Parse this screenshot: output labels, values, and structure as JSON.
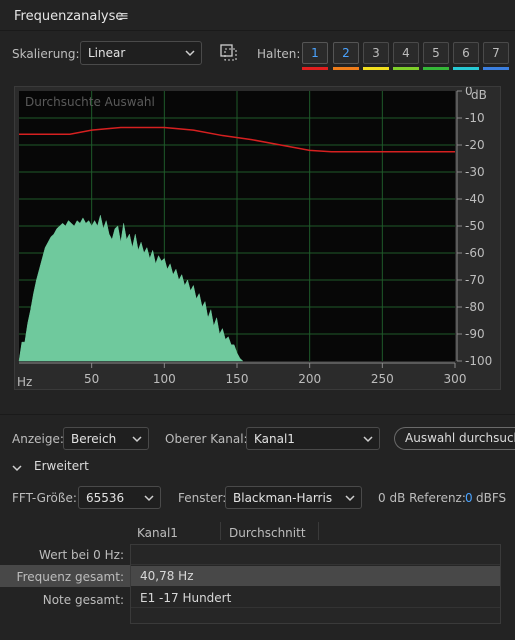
{
  "panel": {
    "title": "Frequenzanalyse",
    "menu_glyph": "≡"
  },
  "toolbar": {
    "scale_label": "Skalierung:",
    "scale_value": "Linear",
    "hold_label": "Halten:",
    "hold_buttons": [
      {
        "label": "1",
        "color": "#e01e1e",
        "active": true
      },
      {
        "label": "2",
        "color": "#f07d1a",
        "active": true
      },
      {
        "label": "3",
        "color": "#f2df1e",
        "active": false
      },
      {
        "label": "4",
        "color": "#7fcf2a",
        "active": false
      },
      {
        "label": "5",
        "color": "#35b838",
        "active": false
      },
      {
        "label": "6",
        "color": "#27c9d4",
        "active": false
      },
      {
        "label": "7",
        "color": "#3b7fe0",
        "active": false
      }
    ]
  },
  "graph": {
    "overlay_label": "Durchsuchte Auswahl",
    "y_unit": "dB",
    "x_unit": "Hz"
  },
  "chart_data": {
    "type": "area",
    "xlim": [
      0,
      300
    ],
    "ylim": [
      -100,
      0
    ],
    "x_ticks": [
      50,
      100,
      150,
      200,
      250,
      300
    ],
    "y_ticks": [
      0,
      -10,
      -20,
      -30,
      -40,
      -50,
      -60,
      -70,
      -80,
      -90,
      -100
    ],
    "series": [
      {
        "style": "line",
        "color": "#d62020",
        "x": [
          0,
          20,
          35,
          50,
          70,
          100,
          120,
          140,
          160,
          180,
          200,
          215,
          230,
          260,
          300
        ],
        "y": [
          -16,
          -16,
          -16,
          -14.5,
          -13.5,
          -13.5,
          -14.5,
          -16.5,
          -18,
          -20,
          -22,
          -22.5,
          -22.5,
          -22.5,
          -22.5
        ]
      },
      {
        "style": "area",
        "color": "#6fc99d",
        "x": [
          0,
          2,
          4,
          6,
          8,
          10,
          12,
          14,
          16,
          18,
          20,
          22,
          24,
          26,
          28,
          30,
          32,
          34,
          36,
          38,
          40,
          42,
          44,
          46,
          48,
          50,
          52,
          54,
          56,
          58,
          60,
          62,
          64,
          66,
          68,
          70,
          72,
          74,
          76,
          78,
          80,
          82,
          84,
          86,
          88,
          90,
          92,
          94,
          96,
          98,
          100,
          102,
          104,
          106,
          108,
          110,
          112,
          114,
          116,
          118,
          120,
          122,
          124,
          126,
          128,
          130,
          132,
          134,
          136,
          138,
          140,
          142,
          144,
          146,
          148,
          150,
          152,
          154
        ],
        "y": [
          -100,
          -93,
          -93,
          -86,
          -81,
          -75,
          -70,
          -66,
          -62,
          -58,
          -56,
          -54,
          -53,
          -51,
          -50,
          -49,
          -50,
          -48,
          -49,
          -50,
          -48,
          -49,
          -47,
          -49,
          -48,
          -50,
          -48,
          -50,
          -46,
          -51,
          -48,
          -53,
          -55,
          -51,
          -50,
          -56,
          -49,
          -55,
          -53,
          -58,
          -53,
          -59,
          -56,
          -60,
          -58,
          -62,
          -59,
          -64,
          -61,
          -63,
          -62,
          -66,
          -64,
          -68,
          -66,
          -70,
          -68,
          -72,
          -70,
          -74,
          -72,
          -77,
          -75,
          -80,
          -78,
          -84,
          -81,
          -87,
          -84,
          -90,
          -88,
          -92,
          -91,
          -94,
          -94,
          -97,
          -99,
          -100
        ]
      }
    ]
  },
  "controls": {
    "display_label": "Anzeige:",
    "display_value": "Bereich",
    "channel_label": "Oberer Kanal:",
    "channel_value": "Kanal1",
    "scan_button": "Auswahl durchsuchen"
  },
  "advanced": {
    "label": "Erweitert",
    "fft_label": "FFT-Größe:",
    "fft_value": "65536",
    "window_label": "Fenster:",
    "window_value": "Blackman-Harris",
    "ref_label": "0 dB Referenz:",
    "ref_value": "0",
    "ref_unit": "dBFS"
  },
  "table": {
    "columns": [
      "Kanal1",
      "Durchschnitt"
    ],
    "rows": [
      {
        "label": "Wert bei 0 Hz:",
        "value": ""
      },
      {
        "label": "Frequenz gesamt:",
        "value": "40,78 Hz"
      },
      {
        "label": "Note gesamt:",
        "value": "E1 -17 Hundert"
      }
    ]
  }
}
